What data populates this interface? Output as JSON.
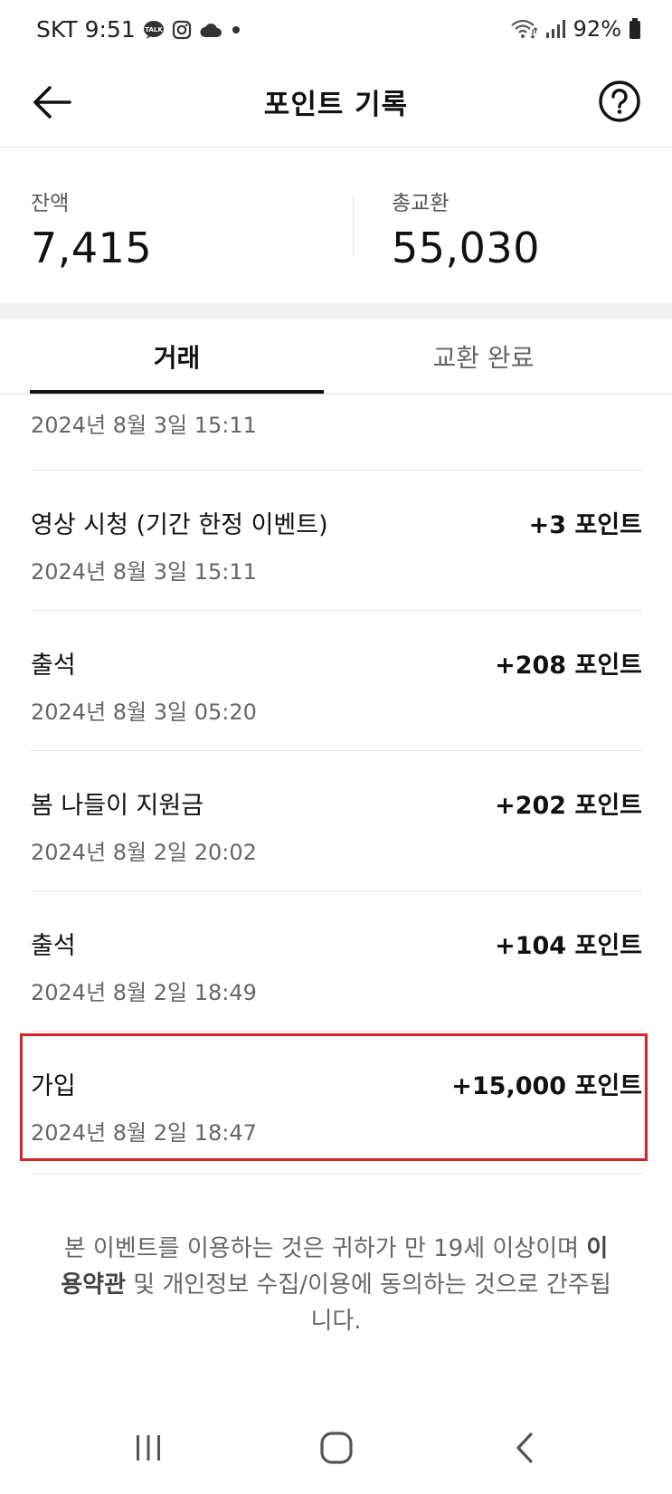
{
  "status_bar": {
    "carrier": "SKT",
    "time": "9:51",
    "talk_badge": "TALK",
    "battery": "92%"
  },
  "header": {
    "title": "포인트 기록"
  },
  "summary": {
    "balance_label": "잔액",
    "balance_value": "7,415",
    "total_label": "총교환",
    "total_value": "55,030"
  },
  "tabs": [
    {
      "label": "거래"
    },
    {
      "label": "교환 완료"
    }
  ],
  "transactions": {
    "first_date": "2024년 8월 3일 15:11",
    "items": [
      {
        "title": "영상 시청 (기간 한정 이벤트)",
        "points": "+3 포인트",
        "date": "2024년 8월 3일 15:11"
      },
      {
        "title": "출석",
        "points": "+208 포인트",
        "date": "2024년 8월 3일 05:20"
      },
      {
        "title": "봄 나들이 지원금",
        "points": "+202 포인트",
        "date": "2024년 8월 2일 20:02"
      },
      {
        "title": "출석",
        "points": "+104 포인트",
        "date": "2024년 8월 2일 18:49"
      },
      {
        "title": "가입",
        "points": "+15,000 포인트",
        "date": "2024년 8월 2일 18:47"
      }
    ]
  },
  "notice": {
    "part1": "본 이벤트를 이용하는 것은 귀하가 만 19세 이상이며 ",
    "link": "이용약관",
    "part2": " 및 개인정보 수집/이용에 동의하는 것으로 간주됩니다."
  },
  "colors": {
    "highlight": "#d6232a",
    "text": "#111111",
    "muted": "#666666"
  }
}
